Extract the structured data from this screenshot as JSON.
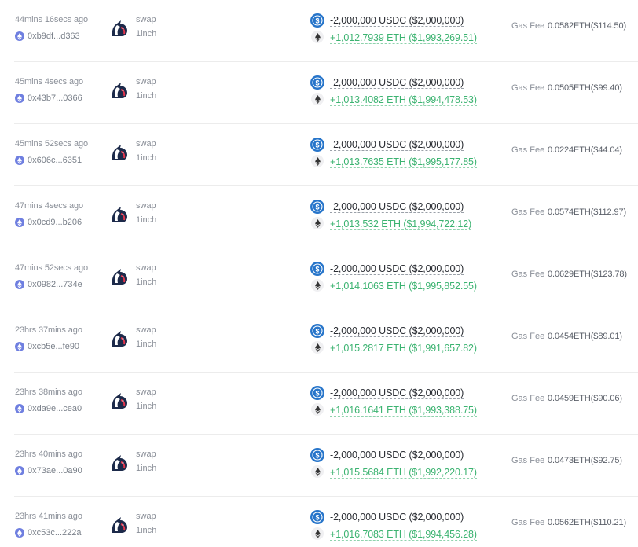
{
  "icons": {
    "network": "ethereum-icon",
    "platform_logo": "1inch-unicorn-icon",
    "out_token": "usdc-icon",
    "in_token": "eth-icon"
  },
  "colors": {
    "positive": "#3cb371",
    "network_dot": "#6f7fe0",
    "usdc": "#2775ca"
  },
  "transactions": [
    {
      "time": "44mins 16secs ago",
      "hash": "0xb9df...d363",
      "action": "swap",
      "platform": "1inch",
      "out_amount": "-2,000,000 USDC ($2,000,000)",
      "in_amount": "+1,012.7939 ETH ($1,993,269.51)",
      "gas_label": "Gas Fee",
      "gas_value": "0.0582ETH($114.50)"
    },
    {
      "time": "45mins 4secs ago",
      "hash": "0x43b7...0366",
      "action": "swap",
      "platform": "1inch",
      "out_amount": "-2,000,000 USDC ($2,000,000)",
      "in_amount": "+1,013.4082 ETH ($1,994,478.53)",
      "gas_label": "Gas Fee",
      "gas_value": "0.0505ETH($99.40)"
    },
    {
      "time": "45mins 52secs ago",
      "hash": "0x606c...6351",
      "action": "swap",
      "platform": "1inch",
      "out_amount": "-2,000,000 USDC ($2,000,000)",
      "in_amount": "+1,013.7635 ETH ($1,995,177.85)",
      "gas_label": "Gas Fee",
      "gas_value": "0.0224ETH($44.04)"
    },
    {
      "time": "47mins 4secs ago",
      "hash": "0x0cd9...b206",
      "action": "swap",
      "platform": "1inch",
      "out_amount": "-2,000,000 USDC ($2,000,000)",
      "in_amount": "+1,013.532 ETH ($1,994,722.12)",
      "gas_label": "Gas Fee",
      "gas_value": "0.0574ETH($112.97)"
    },
    {
      "time": "47mins 52secs ago",
      "hash": "0x0982...734e",
      "action": "swap",
      "platform": "1inch",
      "out_amount": "-2,000,000 USDC ($2,000,000)",
      "in_amount": "+1,014.1063 ETH ($1,995,852.55)",
      "gas_label": "Gas Fee",
      "gas_value": "0.0629ETH($123.78)"
    },
    {
      "time": "23hrs 37mins ago",
      "hash": "0xcb5e...fe90",
      "action": "swap",
      "platform": "1inch",
      "out_amount": "-2,000,000 USDC ($2,000,000)",
      "in_amount": "+1,015.2817 ETH ($1,991,657.82)",
      "gas_label": "Gas Fee",
      "gas_value": "0.0454ETH($89.01)"
    },
    {
      "time": "23hrs 38mins ago",
      "hash": "0xda9e...cea0",
      "action": "swap",
      "platform": "1inch",
      "out_amount": "-2,000,000 USDC ($2,000,000)",
      "in_amount": "+1,016.1641 ETH ($1,993,388.75)",
      "gas_label": "Gas Fee",
      "gas_value": "0.0459ETH($90.06)"
    },
    {
      "time": "23hrs 40mins ago",
      "hash": "0x73ae...0a90",
      "action": "swap",
      "platform": "1inch",
      "out_amount": "-2,000,000 USDC ($2,000,000)",
      "in_amount": "+1,015.5684 ETH ($1,992,220.17)",
      "gas_label": "Gas Fee",
      "gas_value": "0.0473ETH($92.75)"
    },
    {
      "time": "23hrs 41mins ago",
      "hash": "0xc53c...222a",
      "action": "swap",
      "platform": "1inch",
      "out_amount": "-2,000,000 USDC ($2,000,000)",
      "in_amount": "+1,016.7083 ETH ($1,994,456.28)",
      "gas_label": "Gas Fee",
      "gas_value": "0.0562ETH($110.21)"
    }
  ]
}
